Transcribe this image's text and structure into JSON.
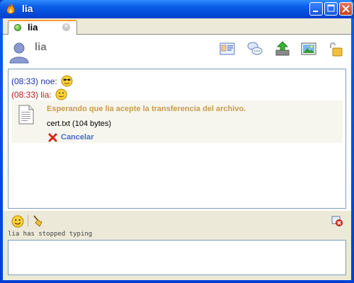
{
  "window": {
    "title": "lia"
  },
  "tab": {
    "label": "lia",
    "status_color": "#3aa020"
  },
  "header": {
    "contact_name": "lia"
  },
  "toolbar": {
    "icons": [
      "contact-card-icon",
      "chat-bubbles-icon",
      "send-file-icon",
      "image-icon",
      "lock-icon"
    ]
  },
  "messages": [
    {
      "time": "(08:33)",
      "sender": "noe:",
      "emoticon": "cool-smiley-icon",
      "color": "#1a2fb0"
    },
    {
      "time": "(08:33)",
      "sender": "lia:",
      "emoticon": "smiley-icon",
      "color": "#c01818"
    }
  ],
  "transfer": {
    "status": "Esperando que lia acepte la transferencia del archivo.",
    "file": "cert.txt (104 bytes)",
    "cancel_label": "Cancelar"
  },
  "typing_status": "lia has stopped typing",
  "input": {
    "value": ""
  }
}
